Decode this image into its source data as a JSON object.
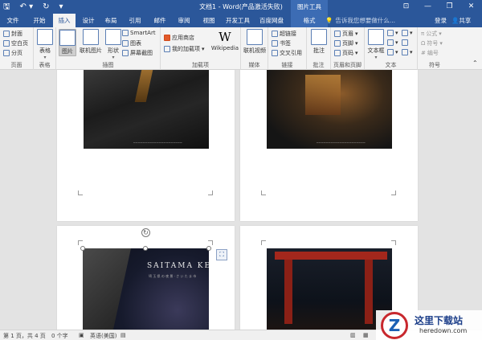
{
  "title_bar": {
    "save_icon": "save-icon",
    "undo_icon": "undo-icon",
    "redo_icon": "redo-icon",
    "customize_icon": "chevron-down-icon",
    "document_title": "文档1 - Word(产品激活失败)",
    "context_header": "图片工具",
    "ribbon_display_icon": "ribbon-display-icon",
    "minimize_icon": "minimize-icon",
    "restore_icon": "restore-icon",
    "close_icon": "close-icon"
  },
  "tabs": [
    {
      "label": "文件",
      "active": false
    },
    {
      "label": "开始",
      "active": false
    },
    {
      "label": "插入",
      "active": true
    },
    {
      "label": "设计",
      "active": false
    },
    {
      "label": "布局",
      "active": false
    },
    {
      "label": "引用",
      "active": false
    },
    {
      "label": "邮件",
      "active": false
    },
    {
      "label": "审阅",
      "active": false
    },
    {
      "label": "视图",
      "active": false
    },
    {
      "label": "开发工具",
      "active": false
    },
    {
      "label": "百度网盘",
      "active": false
    },
    {
      "label": "格式",
      "active": false,
      "contextual": true
    }
  ],
  "tell_me": "告诉我您想要做什么...",
  "account": {
    "login": "登录",
    "share": "共享"
  },
  "ribbon": {
    "pages_group": {
      "label": "页面",
      "cover": "封面",
      "blank": "空白页",
      "break": "分页"
    },
    "table_group": {
      "label": "表格",
      "table": "表格"
    },
    "illustrations_group": {
      "label": "插图",
      "picture": "图片",
      "online_picture": "联机图片",
      "shapes": "形状",
      "smartart": "SmartArt",
      "chart": "图表",
      "screenshot": "屏幕截图"
    },
    "addins_group": {
      "label": "加载项",
      "store": "应用商店",
      "my_addins": "我的加载项",
      "wikipedia": "Wikipedia",
      "wiki_glyph": "W"
    },
    "media_group": {
      "label": "媒体",
      "online_video": "联机视频"
    },
    "links_group": {
      "label": "链接",
      "hyperlink": "超链接",
      "bookmark": "书签",
      "cross_ref": "交叉引用"
    },
    "comments_group": {
      "label": "批注",
      "comment": "批注"
    },
    "header_footer_group": {
      "label": "页眉和页脚",
      "header": "页眉",
      "footer": "页脚",
      "page_number": "页码"
    },
    "text_group": {
      "label": "文本",
      "textbox": "文本框"
    },
    "symbols_group": {
      "label": "符号",
      "equation": "公式",
      "symbol": "符号",
      "numbering": "编号"
    }
  },
  "document": {
    "page3_title": "SAITAMA KEN",
    "page3_subtitle": "埼 玉 県 の 夜 景 · さ い た ま 市",
    "caption_small": "─────────────────────"
  },
  "status_bar": {
    "page_info": "第 1 页，共 4 页",
    "word_count": "0 个字",
    "language": "英语(美国)"
  },
  "watermark": {
    "logo_letter": "Z",
    "site_name": "这里下载站",
    "site_domain": "heredown.com"
  }
}
